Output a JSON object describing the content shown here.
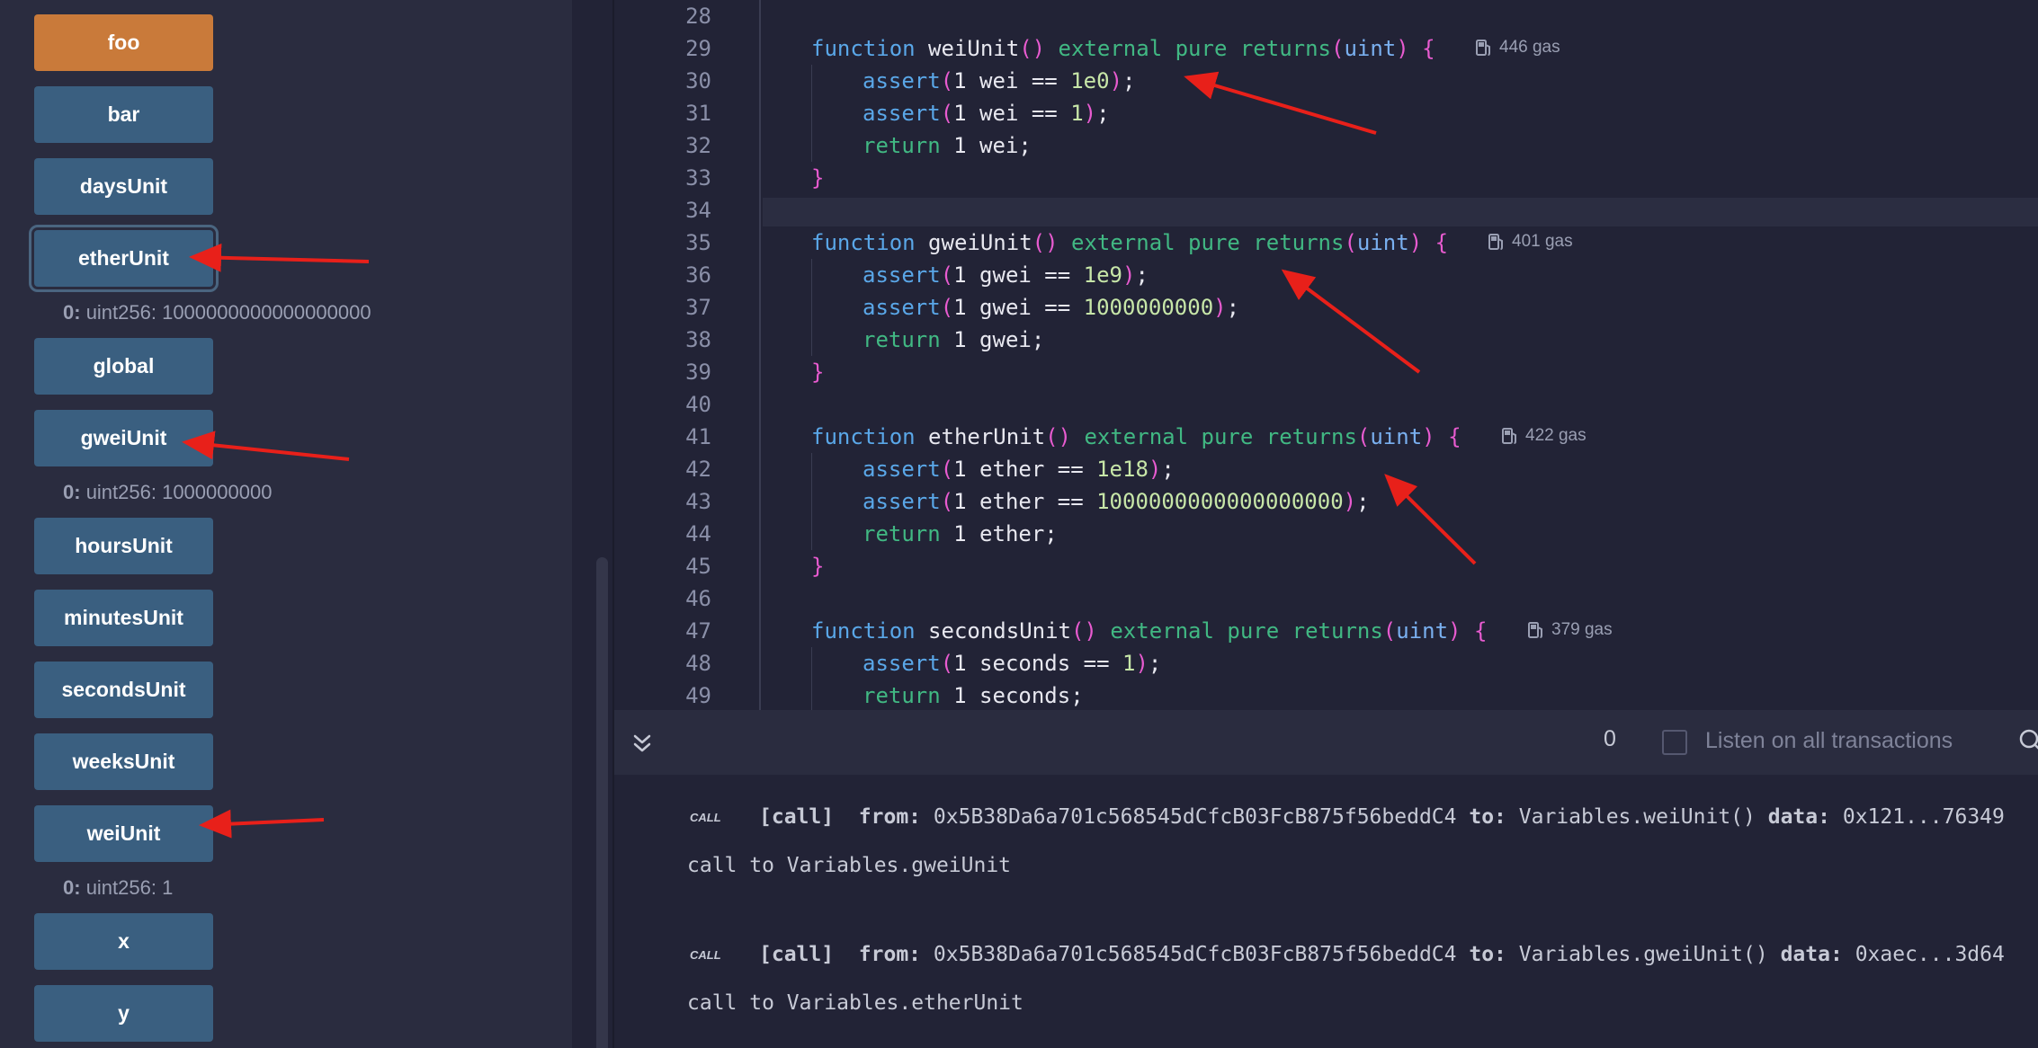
{
  "functions": [
    {
      "label": "foo",
      "primary": true
    },
    {
      "label": "bar"
    },
    {
      "label": "daysUnit"
    },
    {
      "label": "etherUnit",
      "output_index": "0:",
      "output_value": "uint256: 1000000000000000000"
    },
    {
      "label": "global"
    },
    {
      "label": "gweiUnit",
      "output_index": "0:",
      "output_value": "uint256: 1000000000"
    },
    {
      "label": "hoursUnit"
    },
    {
      "label": "minutesUnit"
    },
    {
      "label": "secondsUnit"
    },
    {
      "label": "weeksUnit"
    },
    {
      "label": "weiUnit",
      "output_index": "0:",
      "output_value": "uint256: 1"
    },
    {
      "label": "x"
    },
    {
      "label": "y"
    }
  ],
  "editor": {
    "line_numbers": [
      "28",
      "29",
      "30",
      "31",
      "32",
      "33",
      "34",
      "35",
      "36",
      "37",
      "38",
      "39",
      "40",
      "41",
      "42",
      "43",
      "44",
      "45",
      "46",
      "47",
      "48",
      "49"
    ],
    "gas": {
      "weiUnit": "446 gas",
      "gweiUnit": "401 gas",
      "etherUnit": "422 gas",
      "secondsUnit": "379 gas"
    }
  },
  "terminal": {
    "count": "0",
    "listen_label": "Listen on all transactions",
    "logs": [
      {
        "badge": "CALL",
        "kind": "[call]",
        "from_label": "from:",
        "from": "0x5B38Da6a701c568545dCfcB03FcB875f56beddC4",
        "to_label": "to:",
        "to": "Variables.weiUnit()",
        "data_label": "data:",
        "data": "0x121...76349",
        "message": "call to Variables.gweiUnit"
      },
      {
        "badge": "CALL",
        "kind": "[call]",
        "from_label": "from:",
        "from": "0x5B38Da6a701c568545dCfcB03FcB875f56beddC4",
        "to_label": "to:",
        "to": "Variables.gweiUnit()",
        "data_label": "data:",
        "data": "0xaec...3d64",
        "message": "call to Variables.etherUnit"
      }
    ]
  },
  "colors": {
    "primary_button": "#c97a3a",
    "button": "#3a5f80",
    "annotation_arrow": "#e8201a"
  }
}
